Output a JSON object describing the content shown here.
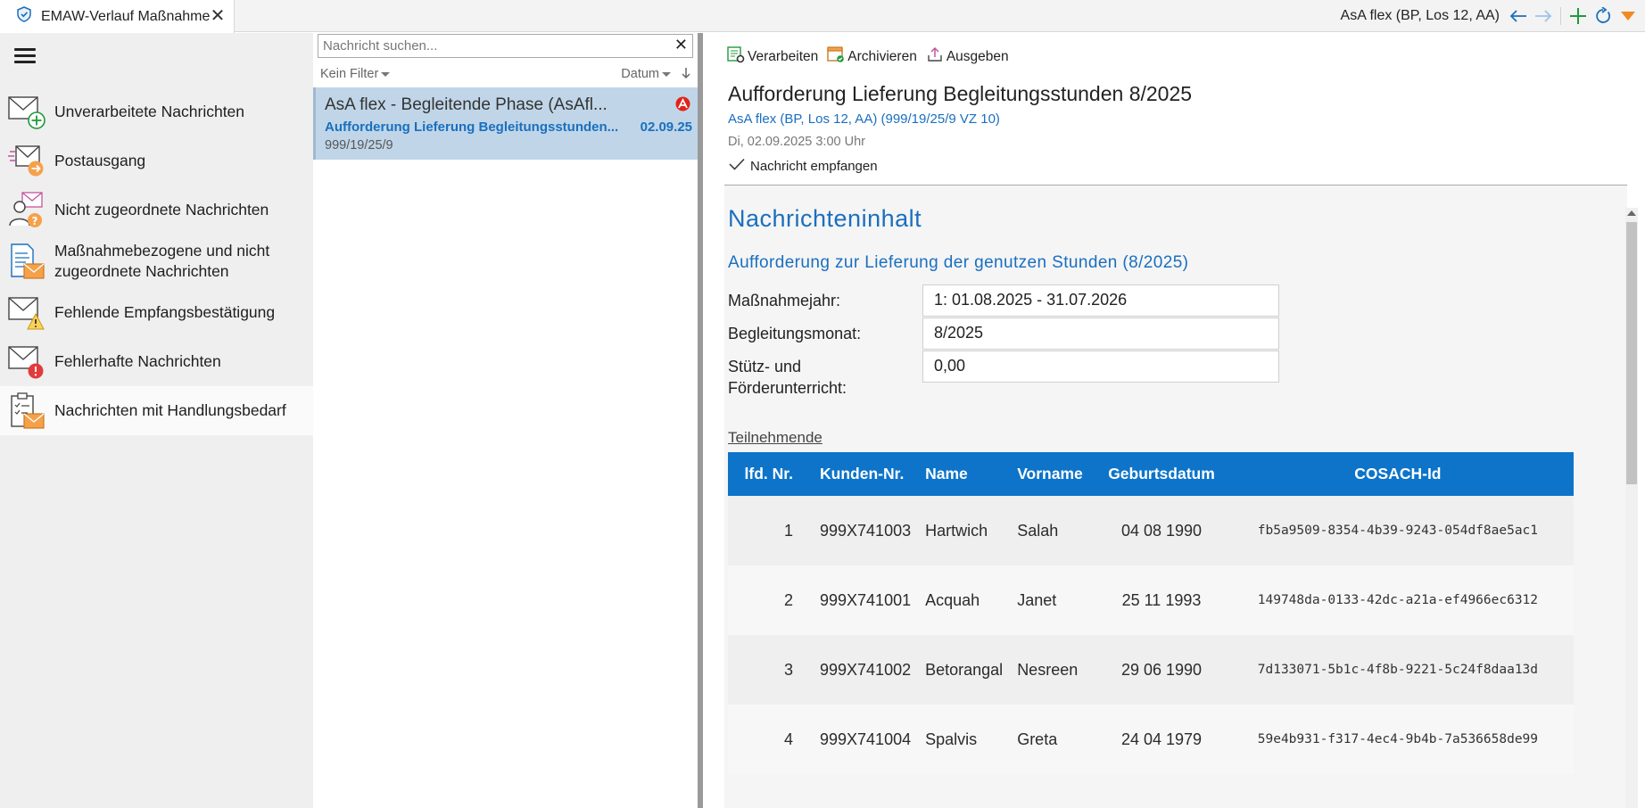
{
  "window": {
    "tab_title": "EMAW-Verlauf Maßnahme",
    "context": "AsA flex (BP, Los 12, AA)"
  },
  "nav": {
    "items": [
      {
        "label": "Unverarbeitete Nachrichten"
      },
      {
        "label": "Postausgang"
      },
      {
        "label": "Nicht zugeordnete Nachrichten"
      },
      {
        "label": "Maßnahmebezogene und nicht zugeordnete Nachrichten"
      },
      {
        "label": "Fehlende Empfangsbestätigung"
      },
      {
        "label": "Fehlerhafte Nachrichten"
      },
      {
        "label": "Nachrichten mit Handlungsbedarf"
      }
    ]
  },
  "list": {
    "search_placeholder": "Nachricht suchen...",
    "filter_label": "Kein Filter",
    "sort_label": "Datum",
    "messages": [
      {
        "title": "AsA flex - Begleitende Phase (AsAfl...",
        "subject": "Aufforderung Lieferung Begleitungsstunden...",
        "date": "02.09.25",
        "reference": "999/19/25/9"
      }
    ]
  },
  "detail": {
    "toolbar": {
      "process": "Verarbeiten",
      "archive": "Archivieren",
      "output": "Ausgeben"
    },
    "subject": "Aufforderung Lieferung Begleitungsstunden 8/2025",
    "context_link": "AsA flex (BP, Los 12, AA) (999/19/25/9 VZ 10)",
    "datetime": "Di, 02.09.2025 3:00 Uhr",
    "status": "Nachricht empfangen",
    "content": {
      "heading": "Nachrichteninhalt",
      "subheading": "Aufforderung zur Lieferung der genutzen Stunden (8/2025)",
      "fields": [
        {
          "label": "Maßnahmejahr:",
          "value": "1: 01.08.2025 - 31.07.2026"
        },
        {
          "label": "Begleitungsmonat:",
          "value": "8/2025"
        },
        {
          "label": "Stütz- und\nFörderunterricht:",
          "value": "0,00"
        }
      ],
      "participants_label": "Teilnehmende",
      "table": {
        "headers": [
          "lfd. Nr.",
          "Kunden-Nr.",
          "Name",
          "Vorname",
          "Geburtsdatum",
          "COSACH-Id"
        ],
        "rows": [
          [
            "1",
            "999X741003",
            "Hartwich",
            "Salah",
            "04 08 1990",
            "fb5a9509-8354-4b39-9243-054df8ae5ac1"
          ],
          [
            "2",
            "999X741001",
            "Acquah",
            "Janet",
            "25 11 1993",
            "149748da-0133-42dc-a21a-ef4966ec6312"
          ],
          [
            "3",
            "999X741002",
            "Betorangal",
            "Nesreen",
            "29 06 1990",
            "7d133071-5b1c-4f8b-9221-5c24f8daa13d"
          ],
          [
            "4",
            "999X741004",
            "Spalvis",
            "Greta",
            "24 04 1979",
            "59e4b931-f317-4ec4-9b4b-7a536658de99"
          ]
        ]
      }
    }
  },
  "colors": {
    "accent": "#1a6fbf",
    "table_header": "#0d74c9",
    "selection": "#c0d6e8"
  }
}
